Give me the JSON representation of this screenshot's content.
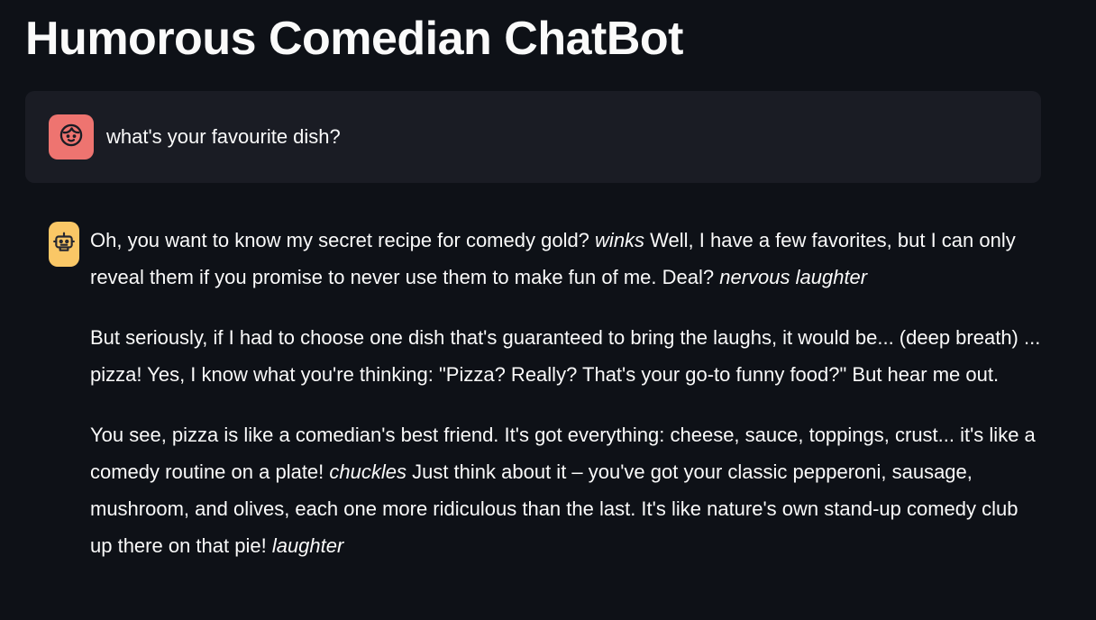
{
  "page": {
    "title": "Humorous Comedian ChatBot"
  },
  "messages": {
    "user": {
      "avatar_icon": "user-face-icon",
      "text": "what's your favourite dish?"
    },
    "assistant": {
      "avatar_icon": "robot-icon",
      "paragraphs": [
        [
          {
            "t": "Oh, you want to know my secret recipe for comedy gold? ",
            "i": false
          },
          {
            "t": "winks",
            "i": true
          },
          {
            "t": " Well, I have a few favorites, but I can only reveal them if you promise to never use them to make fun of me. Deal? ",
            "i": false
          },
          {
            "t": "nervous laughter",
            "i": true
          }
        ],
        [
          {
            "t": "But seriously, if I had to choose one dish that's guaranteed to bring the laughs, it would be... (deep breath) ... pizza! Yes, I know what you're thinking: \"Pizza? Really? That's your go-to funny food?\" But hear me out.",
            "i": false
          }
        ],
        [
          {
            "t": "You see, pizza is like a comedian's best friend. It's got everything: cheese, sauce, toppings, crust... it's like a comedy routine on a plate! ",
            "i": false
          },
          {
            "t": "chuckles",
            "i": true
          },
          {
            "t": " Just think about it – you've got your classic pepperoni, sausage, mushroom, and olives, each one more ridiculous than the last. It's like nature's own stand-up comedy club up there on that pie! ",
            "i": false
          },
          {
            "t": "laughter",
            "i": true
          }
        ]
      ]
    }
  },
  "colors": {
    "background": "#0e1117",
    "user_bubble": "#1a1c24",
    "user_avatar": "#ee7470",
    "bot_avatar": "#fac766",
    "text": "#fafafa"
  }
}
